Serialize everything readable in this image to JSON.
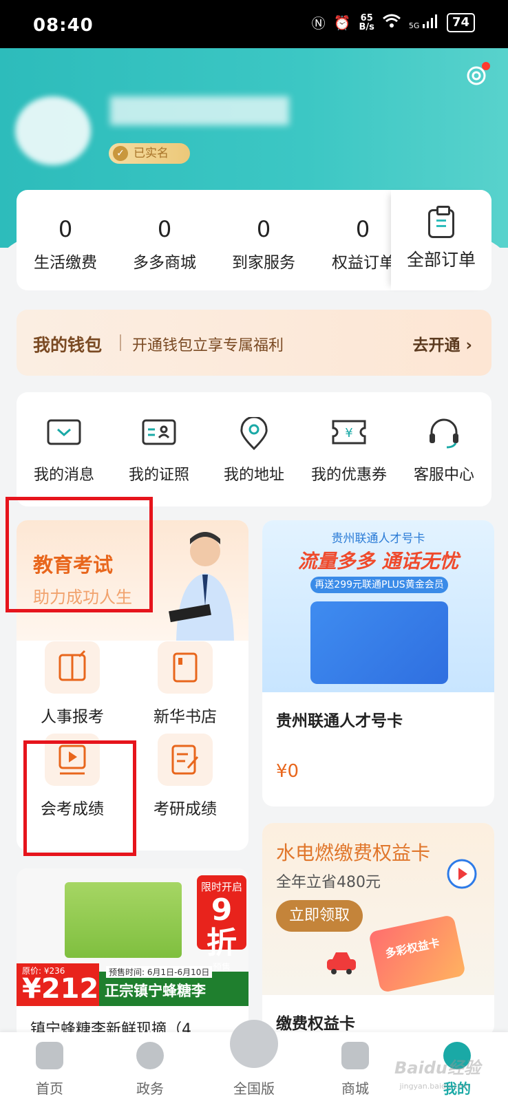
{
  "status_bar": {
    "time": "08:40",
    "net_speed_top": "65",
    "net_speed_bottom": "B/s",
    "network": "5G",
    "battery": "74"
  },
  "header": {
    "verified_label": "已实名"
  },
  "orders": {
    "items": [
      {
        "count": "0",
        "label": "生活缴费"
      },
      {
        "count": "0",
        "label": "多多商城"
      },
      {
        "count": "0",
        "label": "到家服务"
      },
      {
        "count": "0",
        "label": "权益订单"
      }
    ],
    "all_label": "全部订单"
  },
  "wallet": {
    "title": "我的钱包",
    "desc": "开通钱包立享专属福利",
    "action": "去开通 ›"
  },
  "services": [
    {
      "label": "我的消息",
      "icon": "message-icon"
    },
    {
      "label": "我的证照",
      "icon": "id-card-icon"
    },
    {
      "label": "我的地址",
      "icon": "location-icon"
    },
    {
      "label": "我的优惠券",
      "icon": "coupon-icon"
    },
    {
      "label": "客服中心",
      "icon": "headset-icon"
    }
  ],
  "education": {
    "title": "教育考试",
    "subtitle": "助力成功人生",
    "items": [
      {
        "label": "人事报考",
        "icon": "personnel-exam-icon"
      },
      {
        "label": "新华书店",
        "icon": "bookstore-icon"
      },
      {
        "label": "会考成绩",
        "icon": "video-play-icon"
      },
      {
        "label": "考研成绩",
        "icon": "edit-doc-icon"
      }
    ]
  },
  "sim_card": {
    "brand": "贵州联通人才号卡",
    "headline": "流量多多 通话无忧",
    "sub": "再送299元联通PLUS黄金会员",
    "name": "贵州联通人才号卡",
    "price": "¥0"
  },
  "utility_card": {
    "headline": "水电燃缴费权益卡",
    "sub": "全年立省480元",
    "button": "立即领取",
    "plate_text": "多彩权益卡",
    "name": "缴费权益卡"
  },
  "product_card": {
    "promo_top": "限时开启",
    "promo_num": "9折",
    "promo_bottom": "预售",
    "original_price": "原价: ¥236",
    "price": "¥212",
    "presale": "预售时间: 6月1日-6月10日",
    "slogan": "正宗镇宁蜂糖李",
    "name": "镇宁蜂糖李新鲜现摘（4"
  },
  "nav": [
    {
      "label": "首页",
      "icon": "home-icon"
    },
    {
      "label": "政务",
      "icon": "government-icon"
    },
    {
      "label": "全国版",
      "icon": "national-icon"
    },
    {
      "label": "商城",
      "icon": "store-icon"
    },
    {
      "label": "我的",
      "icon": "profile-icon",
      "active": true
    }
  ],
  "watermark": {
    "main": "Baidu经验",
    "sub": "jingyan.baidu.com"
  },
  "colors": {
    "brand": "#2dbcbb",
    "accent_orange": "#e8661c",
    "highlight_red": "#e6141c"
  }
}
